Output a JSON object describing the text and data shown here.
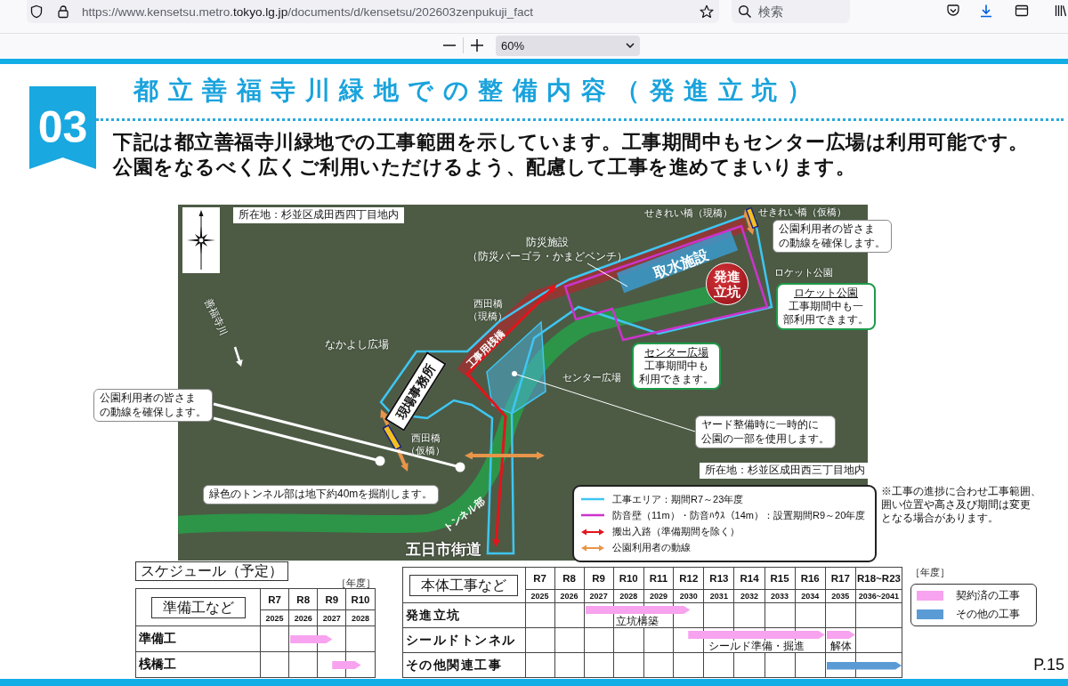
{
  "browser": {
    "url": {
      "host_start": "https://www.kensetsu.metro.",
      "domain": "tokyo.lg.jp",
      "path": "/documents/d/kensetsu/202603zenpukuji_fact"
    },
    "search": {
      "placeholder": "検索"
    }
  },
  "pdf_toolbar": {
    "zoom": "60%"
  },
  "section": {
    "number": "03",
    "title": "都立善福寺川緑地での整備内容（発進立坑）"
  },
  "intro": [
    "下記は都立善福寺川緑地での工事範囲を示しています。工事期間中もセンター広場は利用可能です。",
    "公園をなるべく広くご利用いただけるよう、配慮して工事を進めてまいります。"
  ],
  "map": {
    "labels": [
      {
        "kind": "boxed",
        "text": "所在地：杉並区成田西四丁目地内"
      },
      {
        "kind": "plain",
        "text": "防災施設（防災パーゴラ・かまどベンチ）"
      },
      {
        "kind": "plain",
        "text": "せきれい橋（現橋）"
      },
      {
        "kind": "plain",
        "text": "せきれい橋（仮橋）"
      },
      {
        "kind": "callout",
        "text": "公園利用者の皆さまの動線を確保します。"
      },
      {
        "kind": "band",
        "text": "取水施設"
      },
      {
        "kind": "marker",
        "text": "発進立坑"
      },
      {
        "kind": "plain",
        "text": "ロケット公園"
      },
      {
        "kind": "plain",
        "text": "西田橋（現橋）"
      },
      {
        "kind": "notice",
        "heading": "ロケット公園",
        "text": "工事期間中も一部利用できます。"
      },
      {
        "kind": "band",
        "text": "工事用桟橋"
      },
      {
        "kind": "plain",
        "text": "善福寺川"
      },
      {
        "kind": "plain",
        "text": "なかよし広場"
      },
      {
        "kind": "plain",
        "text": "センター広場"
      },
      {
        "kind": "notice",
        "heading": "センター広場",
        "text": "工事期間中も利用できます。"
      },
      {
        "kind": "sign",
        "text": "現場事務所"
      },
      {
        "kind": "callout",
        "text": "公園利用者の皆さまの動線を確保します。"
      },
      {
        "kind": "plain",
        "text": "西田橋（仮橋）"
      },
      {
        "kind": "callout",
        "text": "ヤード整備時に一時的に公園の一部を使用します。"
      },
      {
        "kind": "boxed",
        "text": "所在地：杉並区成田西三丁目地内"
      },
      {
        "kind": "callout",
        "text": "緑色のトンネル部は地下約40mを掘削します。"
      },
      {
        "kind": "band",
        "text": "トンネル部"
      },
      {
        "kind": "road",
        "text": "五日市街道"
      }
    ],
    "legend": [
      {
        "kind": "line",
        "color": "#3ec6f2",
        "label": "工事エリア：期間R7～23年度"
      },
      {
        "kind": "line",
        "color": "#cc33cc",
        "label": "防音壁（11m）・防音ﾊｳｽ（14m）：設置期間R9～20年度"
      },
      {
        "kind": "arrow",
        "color": "#e3141b",
        "label": "搬出入路（準備期間を除く）"
      },
      {
        "kind": "arrow",
        "color": "#e8954a",
        "label": "公園利用者の動線"
      }
    ]
  },
  "note": "※工事の進捗に合わせ工事範囲、囲い位置や高さ及び期間は変更となる場合があります。",
  "schedule": {
    "title": "スケジュール（予定）",
    "tables": [
      {
        "heading": "準備工など",
        "unit": "［年度］",
        "columns": [
          {
            "era": "R7",
            "year": "2025"
          },
          {
            "era": "R8",
            "year": "2026"
          },
          {
            "era": "R9",
            "year": "2027"
          },
          {
            "era": "R10",
            "year": "2028"
          }
        ],
        "rows": [
          {
            "label": "準備工",
            "bars": [
              {
                "color": "#f7a3ef",
                "cells": [
                  {
                    "kind": "empty"
                  },
                  {
                    "kind": "full"
                  },
                  {
                    "kind": "left"
                  },
                  {
                    "kind": "empty"
                  }
                ]
              }
            ]
          },
          {
            "label": "桟橋工",
            "bars": [
              {
                "color": "#f7a3ef",
                "cells": [
                  {
                    "kind": "empty"
                  },
                  {
                    "kind": "empty"
                  },
                  {
                    "kind": "right"
                  },
                  {
                    "kind": "left"
                  }
                ]
              }
            ]
          }
        ]
      },
      {
        "heading": "本体工事など",
        "unit": "［年度］",
        "columns": [
          {
            "era": "R7",
            "year": "2025"
          },
          {
            "era": "R8",
            "year": "2026"
          },
          {
            "era": "R9",
            "year": "2027"
          },
          {
            "era": "R10",
            "year": "2028"
          },
          {
            "era": "R11",
            "year": "2029"
          },
          {
            "era": "R12",
            "year": "2030"
          },
          {
            "era": "R13",
            "year": "2031"
          },
          {
            "era": "R14",
            "year": "2032"
          },
          {
            "era": "R15",
            "year": "2033"
          },
          {
            "era": "R16",
            "year": "2034"
          },
          {
            "era": "R17",
            "year": "2035"
          },
          {
            "era": "R18~R23",
            "year": "2036~2041"
          }
        ],
        "rows": [
          {
            "label": "発進立坑",
            "bars": [
              {
                "color": "#f7a3ef",
                "label": "立坑構築",
                "cells": [
                  {
                    "kind": "empty"
                  },
                  {
                    "kind": "empty"
                  },
                  {
                    "kind": "full"
                  },
                  {
                    "kind": "full"
                  },
                  {
                    "kind": "full"
                  },
                  {
                    "kind": "left"
                  },
                  {
                    "kind": "empty"
                  },
                  {
                    "kind": "empty"
                  },
                  {
                    "kind": "empty"
                  },
                  {
                    "kind": "empty"
                  },
                  {
                    "kind": "empty"
                  },
                  {
                    "kind": "empty"
                  }
                ]
              }
            ]
          },
          {
            "label": "シールドトンネル",
            "bars": [
              {
                "color": "#f7a3ef",
                "label": "シールド準備・掘進",
                "cells": [
                  {
                    "kind": "empty"
                  },
                  {
                    "kind": "empty"
                  },
                  {
                    "kind": "empty"
                  },
                  {
                    "kind": "empty"
                  },
                  {
                    "kind": "empty"
                  },
                  {
                    "kind": "right"
                  },
                  {
                    "kind": "full"
                  },
                  {
                    "kind": "full"
                  },
                  {
                    "kind": "full"
                  },
                  {
                    "kind": "full"
                  },
                  {
                    "kind": "empty"
                  },
                  {
                    "kind": "empty"
                  }
                ]
              },
              {
                "color": "#f7a3ef",
                "label": "解体",
                "cells": [
                  {
                    "kind": "empty"
                  },
                  {
                    "kind": "empty"
                  },
                  {
                    "kind": "empty"
                  },
                  {
                    "kind": "empty"
                  },
                  {
                    "kind": "empty"
                  },
                  {
                    "kind": "empty"
                  },
                  {
                    "kind": "empty"
                  },
                  {
                    "kind": "empty"
                  },
                  {
                    "kind": "empty"
                  },
                  {
                    "kind": "empty"
                  },
                  {
                    "kind": "full"
                  },
                  {
                    "kind": "empty"
                  }
                ]
              }
            ]
          },
          {
            "label": "その他関連工事",
            "bars": [
              {
                "color": "#5b9bd5",
                "cells": [
                  {
                    "kind": "empty"
                  },
                  {
                    "kind": "empty"
                  },
                  {
                    "kind": "empty"
                  },
                  {
                    "kind": "empty"
                  },
                  {
                    "kind": "empty"
                  },
                  {
                    "kind": "empty"
                  },
                  {
                    "kind": "empty"
                  },
                  {
                    "kind": "empty"
                  },
                  {
                    "kind": "empty"
                  },
                  {
                    "kind": "empty"
                  },
                  {
                    "kind": "full"
                  },
                  {
                    "kind": "full"
                  }
                ]
              }
            ]
          }
        ]
      }
    ],
    "legend": [
      {
        "color": "#f7a3ef",
        "label": "契約済の工事"
      },
      {
        "color": "#5b9bd5",
        "label": "その他の工事"
      }
    ],
    "page_number": "P.15"
  }
}
